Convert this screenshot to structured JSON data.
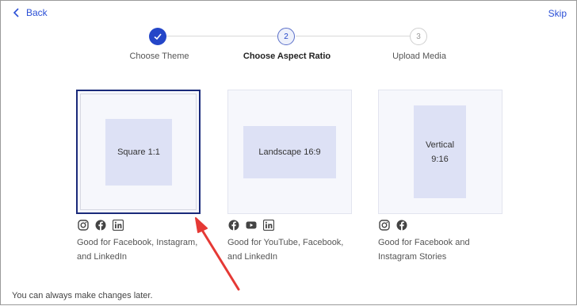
{
  "header": {
    "back_label": "Back",
    "skip_label": "Skip"
  },
  "steps": [
    {
      "label": "Choose Theme",
      "number": "",
      "state": "done"
    },
    {
      "label": "Choose Aspect Ratio",
      "number": "2",
      "state": "current"
    },
    {
      "label": "Upload Media",
      "number": "3",
      "state": "todo"
    }
  ],
  "options": [
    {
      "preview_label": "Square 1:1",
      "platform_icons": [
        "instagram-icon",
        "facebook-icon",
        "linkedin-icon"
      ],
      "description_line1": "Good for Facebook, Instagram,",
      "description_line2": "and LinkedIn",
      "selected": true
    },
    {
      "preview_label": "Landscape 16:9",
      "platform_icons": [
        "facebook-icon",
        "youtube-icon",
        "linkedin-icon"
      ],
      "description_line1": "Good for YouTube, Facebook,",
      "description_line2": "and LinkedIn",
      "selected": false
    },
    {
      "preview_label_line1": "Vertical",
      "preview_label_line2": "9:16",
      "platform_icons": [
        "instagram-icon",
        "facebook-icon"
      ],
      "description_line1": "Good for Facebook and",
      "description_line2": "Instagram Stories",
      "selected": false
    }
  ],
  "footer": {
    "note": "You can always make changes later."
  },
  "colors": {
    "accent": "#2446c8",
    "link": "#2a4fd6",
    "selected_border": "#1a2a7a",
    "annotation_arrow": "#e53935"
  }
}
